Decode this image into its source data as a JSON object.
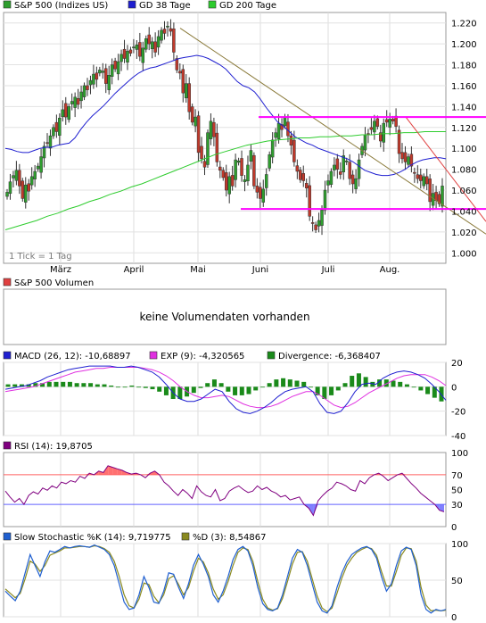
{
  "colors": {
    "up": "#2e9e2e",
    "down": "#c0392b",
    "ma38": "#1f1fd0",
    "ma200": "#2ecc2e",
    "magenta": "#ff00ff",
    "trend": "#8a7a3a",
    "red_trend": "#e04040",
    "macd": "#1f1fd0",
    "exp": "#e030e0",
    "divergence": "#1a8a1a",
    "rsi": "#800080",
    "rsi_fill": "#ff7070",
    "rsi_low_fill": "#8080ff",
    "stoch_k": "#1f5fd0",
    "stoch_d": "#8a8a20",
    "rsi70_line": "#ff6060",
    "rsi30_line": "#6060ff"
  },
  "chart_data": [
    {
      "type": "candlestick",
      "panel": "price",
      "legend": [
        {
          "swatch": "up",
          "label": "S&P 500 (Indizes US)"
        },
        {
          "swatch": "ma38",
          "label": "GD 38 Tage"
        },
        {
          "swatch": "ma200",
          "label": "GD 200 Tage"
        }
      ],
      "x_tick_labels": [
        "März",
        "April",
        "Mai",
        "Juni",
        "Juli",
        "Aug."
      ],
      "y_tick_labels": [
        "1.220",
        "1.200",
        "1.180",
        "1.160",
        "1.140",
        "1.120",
        "1.100",
        "1.080",
        "1.060",
        "1.040",
        "1.020",
        "1.000"
      ],
      "ylim": [
        0.99,
        1.23
      ],
      "footer_note": "1 Tick = 1 Tag",
      "close_values": [
        1.058,
        1.068,
        1.074,
        1.079,
        1.064,
        1.052,
        1.065,
        1.059,
        1.073,
        1.078,
        1.083,
        1.092,
        1.102,
        1.105,
        1.112,
        1.12,
        1.116,
        1.129,
        1.137,
        1.13,
        1.14,
        1.145,
        1.149,
        1.142,
        1.154,
        1.16,
        1.156,
        1.165,
        1.171,
        1.166,
        1.175,
        1.174,
        1.162,
        1.17,
        1.18,
        1.176,
        1.183,
        1.19,
        1.186,
        1.193,
        1.191,
        1.197,
        1.199,
        1.188,
        1.196,
        1.205,
        1.2,
        1.202,
        1.192,
        1.207,
        1.213,
        1.21,
        1.217,
        1.212,
        1.192,
        1.175,
        1.172,
        1.153,
        1.162,
        1.135,
        1.125,
        1.13,
        1.096,
        1.09,
        1.082,
        1.115,
        1.126,
        1.111,
        1.087,
        1.079,
        1.072,
        1.06,
        1.073,
        1.064,
        1.089,
        1.088,
        1.074,
        1.07,
        1.084,
        1.098,
        1.064,
        1.058,
        1.052,
        1.061,
        1.075,
        1.094,
        1.108,
        1.115,
        1.124,
        1.118,
        1.13,
        1.112,
        1.103,
        1.087,
        1.078,
        1.07,
        1.069,
        1.062,
        1.035,
        1.028,
        1.022,
        1.031,
        1.041,
        1.06,
        1.069,
        1.078,
        1.084,
        1.08,
        1.075,
        1.093,
        1.088,
        1.071,
        1.066,
        1.071,
        1.089,
        1.102,
        1.113,
        1.114,
        1.118,
        1.126,
        1.121,
        1.107,
        1.124,
        1.125,
        1.128,
        1.126,
        1.121,
        1.095,
        1.09,
        1.087,
        1.092,
        1.083,
        1.076,
        1.071,
        1.069,
        1.073,
        1.066,
        1.049,
        1.057,
        1.05,
        1.047,
        1.064
      ],
      "ma38": [
        1.1,
        1.099,
        1.097,
        1.096,
        1.096,
        1.098,
        1.1,
        1.101,
        1.101,
        1.103,
        1.104,
        1.105,
        1.11,
        1.118,
        1.125,
        1.131,
        1.136,
        1.141,
        1.147,
        1.153,
        1.158,
        1.163,
        1.168,
        1.172,
        1.175,
        1.177,
        1.178,
        1.18,
        1.182,
        1.184,
        1.186,
        1.187,
        1.188,
        1.189,
        1.188,
        1.186,
        1.183,
        1.18,
        1.176,
        1.17,
        1.164,
        1.16,
        1.158,
        1.154,
        1.147,
        1.139,
        1.132,
        1.125,
        1.121,
        1.116,
        1.111,
        1.108,
        1.105,
        1.103,
        1.1,
        1.098,
        1.096,
        1.094,
        1.092,
        1.09,
        1.087,
        1.083,
        1.079,
        1.077,
        1.075,
        1.074,
        1.074,
        1.075,
        1.077,
        1.08,
        1.084,
        1.087,
        1.089,
        1.09,
        1.091,
        1.091,
        1.09
      ],
      "ma200": [
        1.022,
        1.025,
        1.028,
        1.031,
        1.035,
        1.038,
        1.042,
        1.045,
        1.049,
        1.052,
        1.056,
        1.059,
        1.063,
        1.066,
        1.07,
        1.074,
        1.078,
        1.082,
        1.086,
        1.09,
        1.094,
        1.097,
        1.1,
        1.103,
        1.105,
        1.107,
        1.108,
        1.109,
        1.11,
        1.11,
        1.111,
        1.111,
        1.112,
        1.112,
        1.113,
        1.113,
        1.114,
        1.114,
        1.115,
        1.115,
        1.116,
        1.116,
        1.116
      ],
      "support_line": 1.042,
      "resistance_line": 1.13
    },
    {
      "type": "bar",
      "panel": "volume",
      "legend": [
        {
          "swatch": "red_trend",
          "label": "S&P 500 Volumen"
        }
      ],
      "message": "keine Volumendaten vorhanden"
    },
    {
      "type": "line",
      "panel": "macd",
      "legend": [
        {
          "swatch": "macd",
          "label": "MACD (26, 12): -10,68897"
        },
        {
          "swatch": "exp",
          "label": "EXP (9): -4,320565"
        },
        {
          "swatch": "divergence",
          "label": "Divergence: -6,368407"
        }
      ],
      "y_tick_labels": [
        "20",
        "0",
        "-20",
        "-40"
      ],
      "ylim": [
        -40,
        20
      ],
      "macd": [
        -2,
        -1,
        0,
        1,
        3,
        5,
        8,
        10,
        12,
        14,
        15,
        16,
        17,
        17,
        17,
        17,
        16,
        16,
        17,
        16,
        14,
        12,
        8,
        2,
        -5,
        -10,
        -12,
        -12,
        -10,
        -6,
        -2,
        -4,
        -12,
        -18,
        -21,
        -22,
        -20,
        -17,
        -13,
        -8,
        -4,
        -2,
        -1,
        0,
        -4,
        -14,
        -21,
        -22,
        -20,
        -13,
        -4,
        2,
        3,
        2,
        7,
        10,
        12,
        13,
        12,
        10,
        7,
        2,
        -4,
        -11
      ],
      "exp": [
        -4,
        -3,
        -2,
        -1,
        0,
        2,
        4,
        6,
        8,
        10,
        12,
        13,
        14,
        15,
        15,
        16,
        16,
        16,
        16,
        16,
        15,
        14,
        12,
        9,
        5,
        0,
        -4,
        -7,
        -9,
        -9,
        -8,
        -7,
        -8,
        -11,
        -14,
        -16,
        -17,
        -17,
        -16,
        -14,
        -11,
        -8,
        -6,
        -4,
        -4,
        -7,
        -11,
        -15,
        -17,
        -16,
        -13,
        -9,
        -5,
        -2,
        1,
        4,
        7,
        9,
        10,
        10,
        10,
        8,
        5,
        1
      ],
      "divergence": [
        2,
        2,
        2,
        2,
        3,
        3,
        4,
        4,
        4,
        4,
        3,
        3,
        3,
        2,
        2,
        1,
        0,
        0,
        1,
        0,
        -1,
        -2,
        -4,
        -7,
        -10,
        -10,
        -8,
        -5,
        -1,
        3,
        6,
        3,
        -4,
        -7,
        -7,
        -6,
        -3,
        0,
        3,
        6,
        7,
        6,
        5,
        4,
        0,
        -7,
        -10,
        -7,
        -3,
        3,
        9,
        11,
        8,
        4,
        6,
        6,
        5,
        4,
        2,
        0,
        -3,
        -6,
        -9,
        -12
      ]
    },
    {
      "type": "line",
      "panel": "rsi",
      "legend": [
        {
          "swatch": "rsi",
          "label": "RSI (14): 19,8705"
        }
      ],
      "y_tick_labels": [
        "100",
        "70",
        "50",
        "30",
        "0"
      ],
      "ylim": [
        0,
        100
      ],
      "thresholds": [
        70,
        30
      ],
      "values": [
        48,
        40,
        33,
        38,
        30,
        42,
        47,
        44,
        52,
        49,
        55,
        52,
        60,
        58,
        62,
        60,
        68,
        65,
        72,
        70,
        75,
        73,
        82,
        80,
        78,
        76,
        73,
        71,
        72,
        70,
        66,
        72,
        75,
        70,
        60,
        55,
        48,
        42,
        50,
        45,
        38,
        55,
        47,
        42,
        40,
        50,
        35,
        38,
        48,
        52,
        55,
        50,
        46,
        48,
        55,
        50,
        53,
        48,
        45,
        40,
        42,
        36,
        38,
        40,
        30,
        25,
        15,
        35,
        42,
        48,
        52,
        60,
        58,
        55,
        50,
        48,
        62,
        58,
        66,
        70,
        72,
        68,
        62,
        66,
        70,
        72,
        65,
        58,
        52,
        45,
        40,
        35,
        30,
        22,
        20
      ]
    },
    {
      "type": "line",
      "panel": "stochastic",
      "legend": [
        {
          "swatch": "stoch_k",
          "label": "Slow Stochastic %K (14): 9,719775"
        },
        {
          "swatch": "stoch_d",
          "label": "%D (3): 8,54867"
        }
      ],
      "y_tick_labels": [
        "100",
        "50",
        "0"
      ],
      "ylim": [
        0,
        100
      ],
      "k": [
        35,
        28,
        22,
        35,
        60,
        85,
        70,
        55,
        75,
        90,
        88,
        92,
        96,
        94,
        96,
        97,
        96,
        95,
        98,
        95,
        92,
        85,
        70,
        45,
        20,
        10,
        12,
        30,
        55,
        40,
        20,
        18,
        35,
        60,
        58,
        40,
        25,
        45,
        70,
        85,
        72,
        55,
        30,
        20,
        35,
        55,
        78,
        92,
        96,
        90,
        70,
        40,
        18,
        10,
        8,
        12,
        30,
        55,
        80,
        92,
        88,
        70,
        45,
        20,
        8,
        5,
        15,
        40,
        60,
        75,
        85,
        90,
        94,
        96,
        92,
        80,
        55,
        35,
        45,
        70,
        90,
        95,
        92,
        70,
        30,
        10,
        5,
        10,
        8,
        10
      ],
      "d": [
        38,
        32,
        26,
        32,
        52,
        76,
        72,
        62,
        70,
        84,
        87,
        90,
        94,
        94,
        95,
        96,
        96,
        95,
        97,
        96,
        93,
        88,
        76,
        55,
        30,
        15,
        12,
        24,
        46,
        44,
        28,
        19,
        30,
        52,
        56,
        44,
        30,
        40,
        62,
        80,
        75,
        60,
        38,
        24,
        30,
        48,
        70,
        88,
        94,
        92,
        76,
        48,
        24,
        12,
        9,
        11,
        25,
        48,
        72,
        88,
        89,
        76,
        52,
        28,
        12,
        7,
        12,
        32,
        53,
        70,
        80,
        88,
        92,
        95,
        93,
        84,
        62,
        42,
        42,
        62,
        84,
        94,
        93,
        76,
        40,
        16,
        8,
        9,
        8,
        9
      ]
    }
  ]
}
